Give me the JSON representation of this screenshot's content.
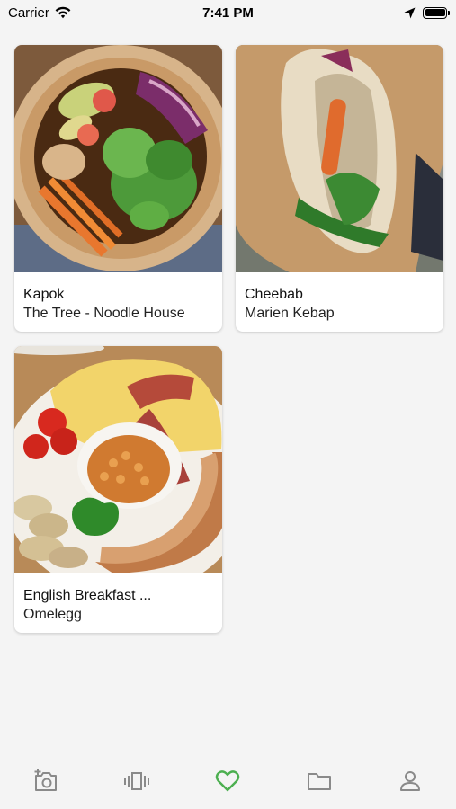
{
  "status_bar": {
    "carrier": "Carrier",
    "time": "7:41 PM"
  },
  "cards": [
    {
      "title": "Kapok",
      "subtitle": "The Tree - Noodle House"
    },
    {
      "title": "Cheebab",
      "subtitle": "Marien Kebap"
    },
    {
      "title": "English Breakfast ...",
      "subtitle": "Omelegg"
    }
  ],
  "bottom_nav": {
    "items": [
      {
        "icon": "add-photo-icon"
      },
      {
        "icon": "carousel-icon"
      },
      {
        "icon": "heart-icon",
        "active": true
      },
      {
        "icon": "folder-icon"
      },
      {
        "icon": "person-icon"
      }
    ],
    "active_color": "#4caf50",
    "inactive_color": "#8a8a8a"
  }
}
